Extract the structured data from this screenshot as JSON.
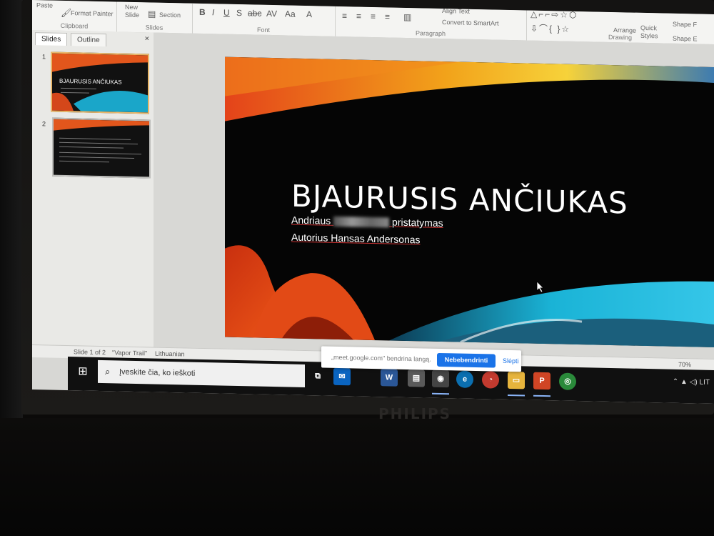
{
  "ribbon": {
    "clipboard": {
      "paste": "Paste",
      "format_painter": "Format Painter",
      "label": "Clipboard"
    },
    "slides": {
      "new_slide": "New\nSlide",
      "section": "Section",
      "label": "Slides"
    },
    "font": {
      "label": "Font"
    },
    "paragraph": {
      "align_text": "Align Text",
      "convert_smartart": "Convert to SmartArt",
      "label": "Paragraph"
    },
    "drawing": {
      "arrange": "Arrange",
      "quick_styles": "Quick\nStyles",
      "shape_fill": "Shape F",
      "shape_effects": "Shape E",
      "label": "Drawing"
    }
  },
  "panel": {
    "tabs": [
      "Slides",
      "Outline"
    ],
    "close": "×",
    "slides": [
      {
        "num": "1",
        "title": "BJAURUSIS ANČIUKAS"
      },
      {
        "num": "2",
        "title": ""
      }
    ]
  },
  "slide": {
    "title": "BJAURUSIS ANČIUKAS",
    "subtitle_prefix": "Andriaus",
    "subtitle_suffix": "pristatymas",
    "author": "Autorius Hansas Andersonas"
  },
  "status": {
    "slide_count": "Slide 1 of 2",
    "theme": "\"Vapor Trail\"",
    "language": "Lithuanian",
    "zoom": "70%"
  },
  "share_bar": {
    "text": "„meet.google.com\" bendrina langą.",
    "stop_button": "Nebebendrinti",
    "hide": "Slėpti"
  },
  "taskbar": {
    "search_placeholder": "Įveskite čia, ko ieškoti",
    "lang": "LIT"
  },
  "monitor": {
    "brand": "PHILIPS"
  },
  "colors": {
    "accent_blue": "#1a73e8",
    "slide_bg": "#050505"
  }
}
